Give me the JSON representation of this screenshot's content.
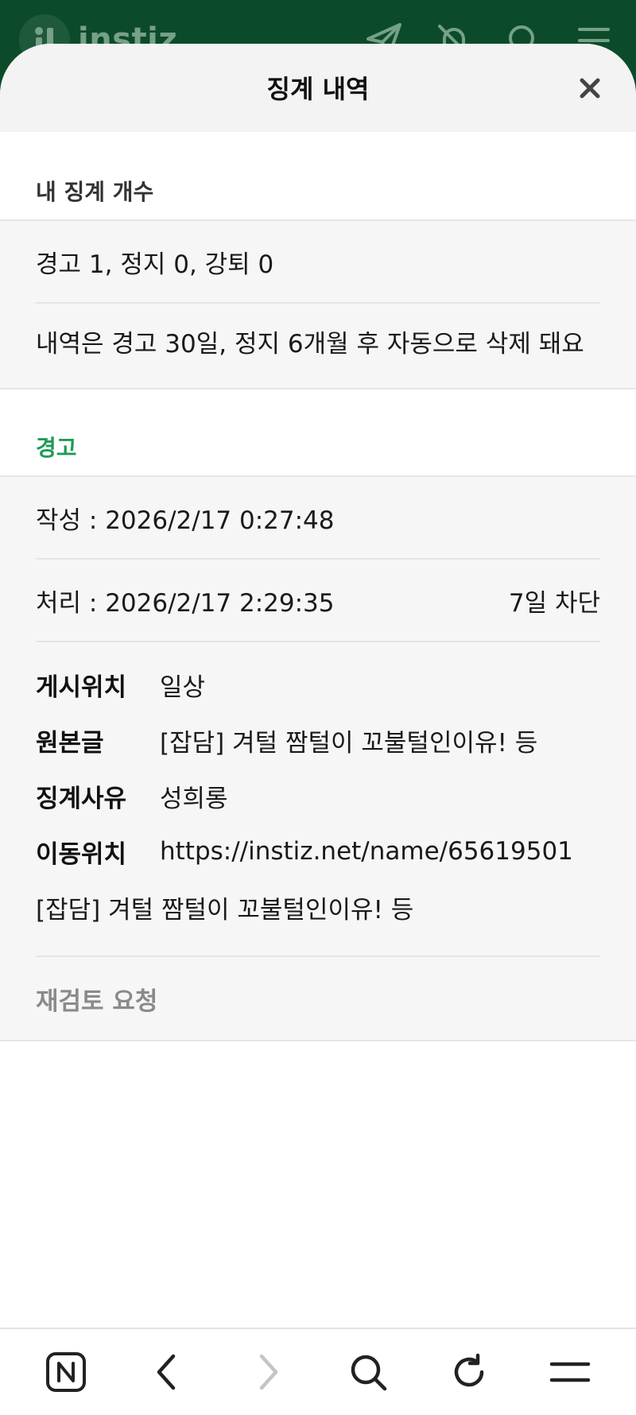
{
  "app_header": {
    "logo_text": "instiz"
  },
  "modal": {
    "title": "징계 내역",
    "close_icon": "close-icon"
  },
  "summary": {
    "heading": "내 징계 개수",
    "counts": "경고 1, 정지 0, 강퇴 0",
    "note": "내역은 경고 30일, 정지 6개월 후 자동으로 삭제 돼요"
  },
  "warning": {
    "heading": "경고",
    "created": "작성 : 2026/2/17 0:27:48",
    "processed": "처리 : 2026/2/17 2:29:35",
    "block_duration": "7일 차단",
    "fields": [
      {
        "label": "게시위치",
        "value": "일상"
      },
      {
        "label": "원본글",
        "value": "[잡담] 겨털 짬털이 꼬불털인이유! 등"
      },
      {
        "label": "징계사유",
        "value": "성희롱"
      },
      {
        "label": "이동위치",
        "value": "https://instiz.net/name/65619501"
      }
    ],
    "moved_title": "[잡담] 겨털 짬털이 꼬불털인이유! 등",
    "review_request": "재검토 요청"
  },
  "bottom_bar": {
    "icons": [
      "n-home-icon",
      "back-icon",
      "forward-icon",
      "search-icon",
      "refresh-icon",
      "menu-icon"
    ]
  },
  "colors": {
    "header_green": "#0b4b2a",
    "accent_green": "#1f9b57",
    "muted_gray": "#8a8a8a"
  }
}
